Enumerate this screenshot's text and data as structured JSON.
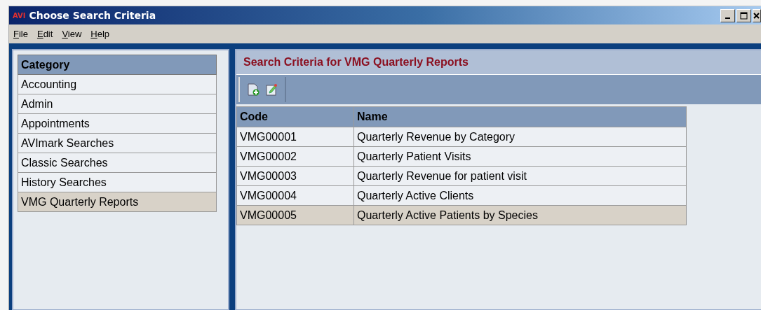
{
  "window": {
    "logo": "AVI",
    "title": "Choose Search Criteria"
  },
  "menu": [
    "File",
    "Edit",
    "View",
    "Help"
  ],
  "category_list": {
    "header": "Category",
    "items": [
      {
        "label": "Accounting",
        "selected": false
      },
      {
        "label": "Admin",
        "selected": false
      },
      {
        "label": "Appointments",
        "selected": false
      },
      {
        "label": "AVImark Searches",
        "selected": false
      },
      {
        "label": "Classic Searches",
        "selected": false
      },
      {
        "label": "History Searches",
        "selected": false
      },
      {
        "label": "VMG Quarterly Reports",
        "selected": true
      }
    ]
  },
  "criteria_panel": {
    "title": "Search Criteria for VMG Quarterly Reports",
    "table": {
      "columns": [
        "Code",
        "Name"
      ],
      "rows": [
        {
          "code": "VMG00001",
          "name": "Quarterly Revenue by Category",
          "selected": false
        },
        {
          "code": "VMG00002",
          "name": "Quarterly Patient Visits",
          "selected": false
        },
        {
          "code": "VMG00003",
          "name": "Quarterly Revenue for patient visit",
          "selected": false
        },
        {
          "code": "VMG00004",
          "name": "Quarterly Active Clients",
          "selected": false
        },
        {
          "code": "VMG00005",
          "name": "Quarterly Active Patients by Species",
          "selected": true
        }
      ]
    }
  }
}
